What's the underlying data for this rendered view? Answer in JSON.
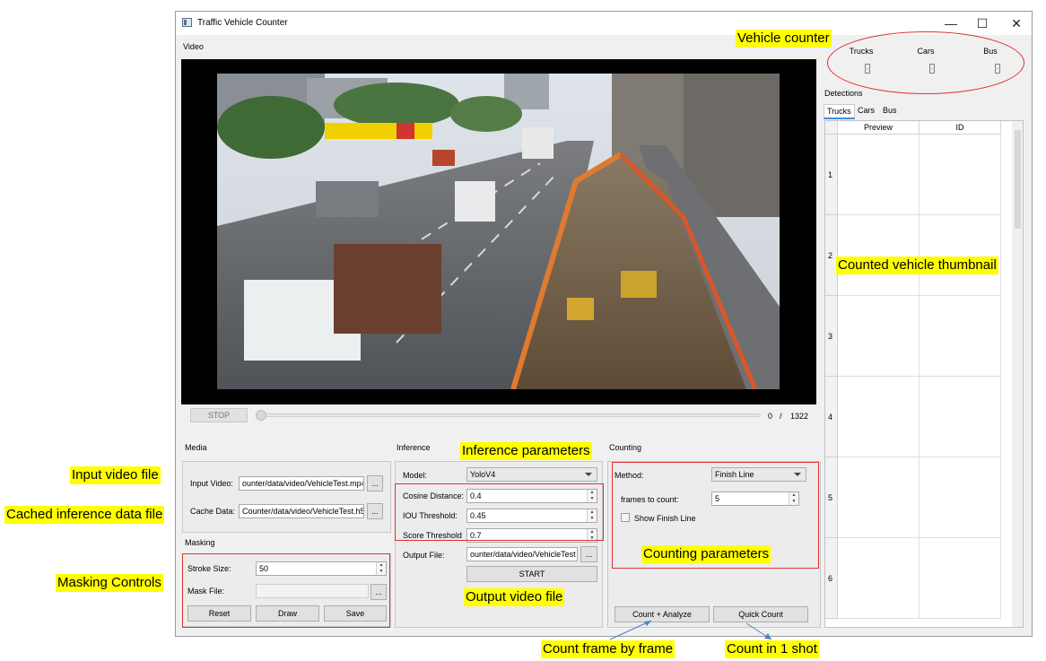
{
  "window": {
    "title": "Traffic Vehicle Counter",
    "minimize": "—",
    "maximize": "☐",
    "close": "✕"
  },
  "video": {
    "section_label": "Video",
    "stop_label": "STOP",
    "current_frame": "0",
    "separator": "/",
    "total_frames": "1322"
  },
  "media": {
    "section_label": "Media",
    "input_video_label": "Input Video:",
    "input_video_value": "ounter/data/video/VehicleTest.mp4",
    "cache_data_label": "Cache Data:",
    "cache_data_value": "Counter/data/video/VehicleTest.h5",
    "browse_label": "..."
  },
  "masking": {
    "section_label": "Masking",
    "stroke_size_label": "Stroke Size:",
    "stroke_size_value": "50",
    "mask_file_label": "Mask File:",
    "mask_file_value": "",
    "browse_label": "...",
    "reset_label": "Reset",
    "draw_label": "Draw",
    "save_label": "Save"
  },
  "inference": {
    "section_label": "Inference",
    "model_label": "Model:",
    "model_value": "YoloV4",
    "cosine_label": "Cosine Distance:",
    "cosine_value": "0.4",
    "iou_label": "IOU Threshold:",
    "iou_value": "0.45",
    "score_label": "Score Threshold",
    "score_value": "0.7",
    "output_label": "Output File:",
    "output_value": "ounter/data/video/VehicleTest",
    "browse_label": "...",
    "start_label": "START"
  },
  "counting": {
    "section_label": "Counting",
    "method_label": "Method:",
    "method_value": "Finish Line",
    "frames_label": "frames to count:",
    "frames_value": "5",
    "show_finish_line_label": "Show Finish Line",
    "count_analyze_label": "Count + Analyze",
    "quick_count_label": "Quick Count"
  },
  "counter": {
    "trucks_label": "Trucks",
    "cars_label": "Cars",
    "bus_label": "Bus"
  },
  "detections": {
    "section_label": "Detections",
    "tabs": [
      "Trucks",
      "Cars",
      "Bus"
    ],
    "columns": [
      "Preview",
      "ID"
    ],
    "rows": [
      "1",
      "2",
      "3",
      "4",
      "5",
      "6"
    ]
  },
  "annotations": {
    "vehicle_counter": "Vehicle counter",
    "counted_thumbnail": "Counted vehicle thumbnail",
    "inference_parameters": "Inference parameters",
    "input_video_file": "Input video file",
    "cached_inference": "Cached inference data file",
    "masking_controls": "Masking Controls",
    "counting_parameters": "Counting parameters",
    "output_video_file": "Output video file",
    "count_frame_by_frame": "Count frame by frame",
    "count_in_1_shot": "Count in 1 shot"
  },
  "colors": {
    "highlight": "#ffff00",
    "annotation_border": "#e03030",
    "tab_accent": "#3c8ee5"
  }
}
